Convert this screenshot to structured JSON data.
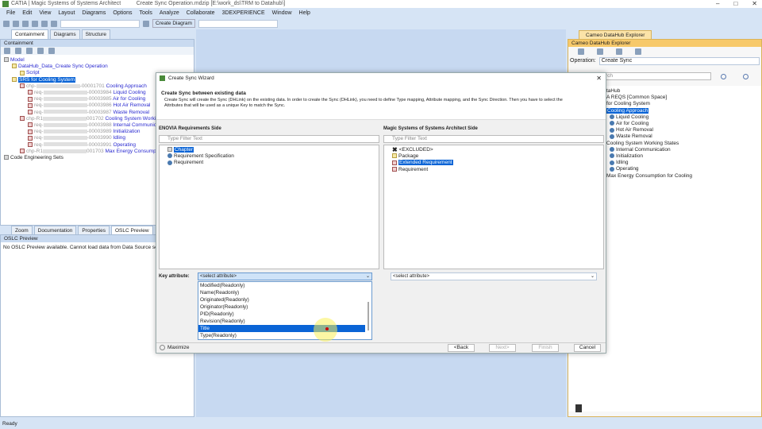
{
  "window": {
    "title": "CATIA | Magic Systems of Systems Architect",
    "title_file": "Create Sync Operation.mdzip [E:\\work_ds\\TRM to Datahub\\]"
  },
  "menu": [
    "File",
    "Edit",
    "View",
    "Layout",
    "Diagrams",
    "Options",
    "Tools",
    "Analyze",
    "Collaborate",
    "3DEXPERIENCE",
    "Window",
    "Help"
  ],
  "toolbar": {
    "create_diagram": "Create Diagram"
  },
  "left_tabs": [
    "Containment",
    "Diagrams",
    "Structure"
  ],
  "containment": {
    "title": "Containment",
    "tree": [
      {
        "label": "Model",
        "depth": 0,
        "icon": "model"
      },
      {
        "label": "DataHub_Data_Create Sync Operation",
        "depth": 1,
        "icon": "folder"
      },
      {
        "label": "Script",
        "depth": 2,
        "icon": "script"
      },
      {
        "label": "SRS for Cooling System",
        "depth": 1,
        "icon": "folder",
        "selected": true
      },
      {
        "prefix": "chp-",
        "suffix": "-00001701",
        "label": "Cooling Approach",
        "depth": 2,
        "icon": "req"
      },
      {
        "prefix": "req-",
        "suffix": "-00003984",
        "label": "Liquid Cooling",
        "depth": 3,
        "icon": "req"
      },
      {
        "prefix": "req-",
        "suffix": "-00003985",
        "label": "Air for Cooling",
        "depth": 3,
        "icon": "req"
      },
      {
        "prefix": "req-",
        "suffix": "-00003986",
        "label": "Hot Air Removal",
        "depth": 3,
        "icon": "req"
      },
      {
        "prefix": "req-",
        "suffix": "-00003987",
        "label": "Waste Removal",
        "depth": 3,
        "icon": "req"
      },
      {
        "prefix": "chp-R1",
        "suffix": "001702",
        "label": "Cooling System Working St",
        "depth": 2,
        "icon": "req"
      },
      {
        "prefix": "req-",
        "suffix": "-00003988",
        "label": "Internal Communication",
        "depth": 3,
        "icon": "req"
      },
      {
        "prefix": "req-",
        "suffix": "-00003989",
        "label": "Initialization",
        "depth": 3,
        "icon": "req"
      },
      {
        "prefix": "req-",
        "suffix": "-00003990",
        "label": "Idling",
        "depth": 3,
        "icon": "req"
      },
      {
        "prefix": "req-",
        "suffix": "-00003991",
        "label": "Operating",
        "depth": 3,
        "icon": "req"
      },
      {
        "prefix": "chp-R1",
        "suffix": "001703",
        "label": "Max Energy Consumption",
        "depth": 2,
        "icon": "req"
      },
      {
        "label": "Code Engineering Sets",
        "depth": 0,
        "icon": "code"
      }
    ]
  },
  "bottom_tabs": [
    "Zoom",
    "Documentation",
    "Properties",
    "OSLC Preview"
  ],
  "oslc": {
    "title": "OSLC Preview",
    "message": "No OSLC Preview available. Cannot load data from Data Source server."
  },
  "dialog": {
    "title": "Create Sync Wizard",
    "heading": "Create Sync between existing data",
    "description": "Create Sync will create the Sync (DHLink) on the existing data. In order to create the Sync (DHLink), you need to define Type mapping, Attribute mapping, and the Sync Direction. Then you have to select the Attributes that will be used as a unique Key to match the Sync.",
    "left_title": "ENOVIA Requirements Side",
    "right_title": "Magic Systems of Systems Architect Side",
    "filter_placeholder": "Type Filter Text",
    "left_items": [
      "Chapter",
      "Requirement Specification",
      "Requirement"
    ],
    "right_items": [
      "<EXCLUDED>",
      "Package",
      "Extended Requirement",
      "Requirement"
    ],
    "key_label": "Key attribute:",
    "key_left_value": "<select attribute>",
    "key_right_value": "<select attribute>",
    "dropdown_options": [
      "Modified(Readonly)",
      "Name(Readonly)",
      "Originated(Readonly)",
      "Originator(Readonly)",
      "PID(Readonly)",
      "Revision(Readonly)",
      "Title",
      "Type(Readonly)"
    ],
    "dropdown_highlighted": "Title",
    "maximize": "Maximize",
    "buttons": {
      "back": "<Back",
      "next": "Next>",
      "finish": "Finish",
      "cancel": "Cancel"
    }
  },
  "datahub": {
    "tab": "Cameo DataHub Explorer",
    "title": "Cameo DataHub Explorer",
    "operation_label": "Operation:",
    "operation_value": "Create Sync",
    "search_partial": "rch",
    "tree": [
      "taHub",
      "A REQS [Common Space]",
      "for Cooling System",
      "Cooling Approach",
      "Liquid Cooling",
      "Air for Cooling",
      "Hot Air Removal",
      "Waste Removal",
      "Cooling System Working States",
      "Internal Communication",
      "Initialization",
      "Idling",
      "Operating",
      "Max Energy Consumption for Cooling"
    ]
  },
  "status": "Ready",
  "colors": {
    "selection": "#0a64d6",
    "link": "#2a2ad0",
    "panel": "#d6e4f5",
    "datahub_header": "#f7c96a"
  }
}
